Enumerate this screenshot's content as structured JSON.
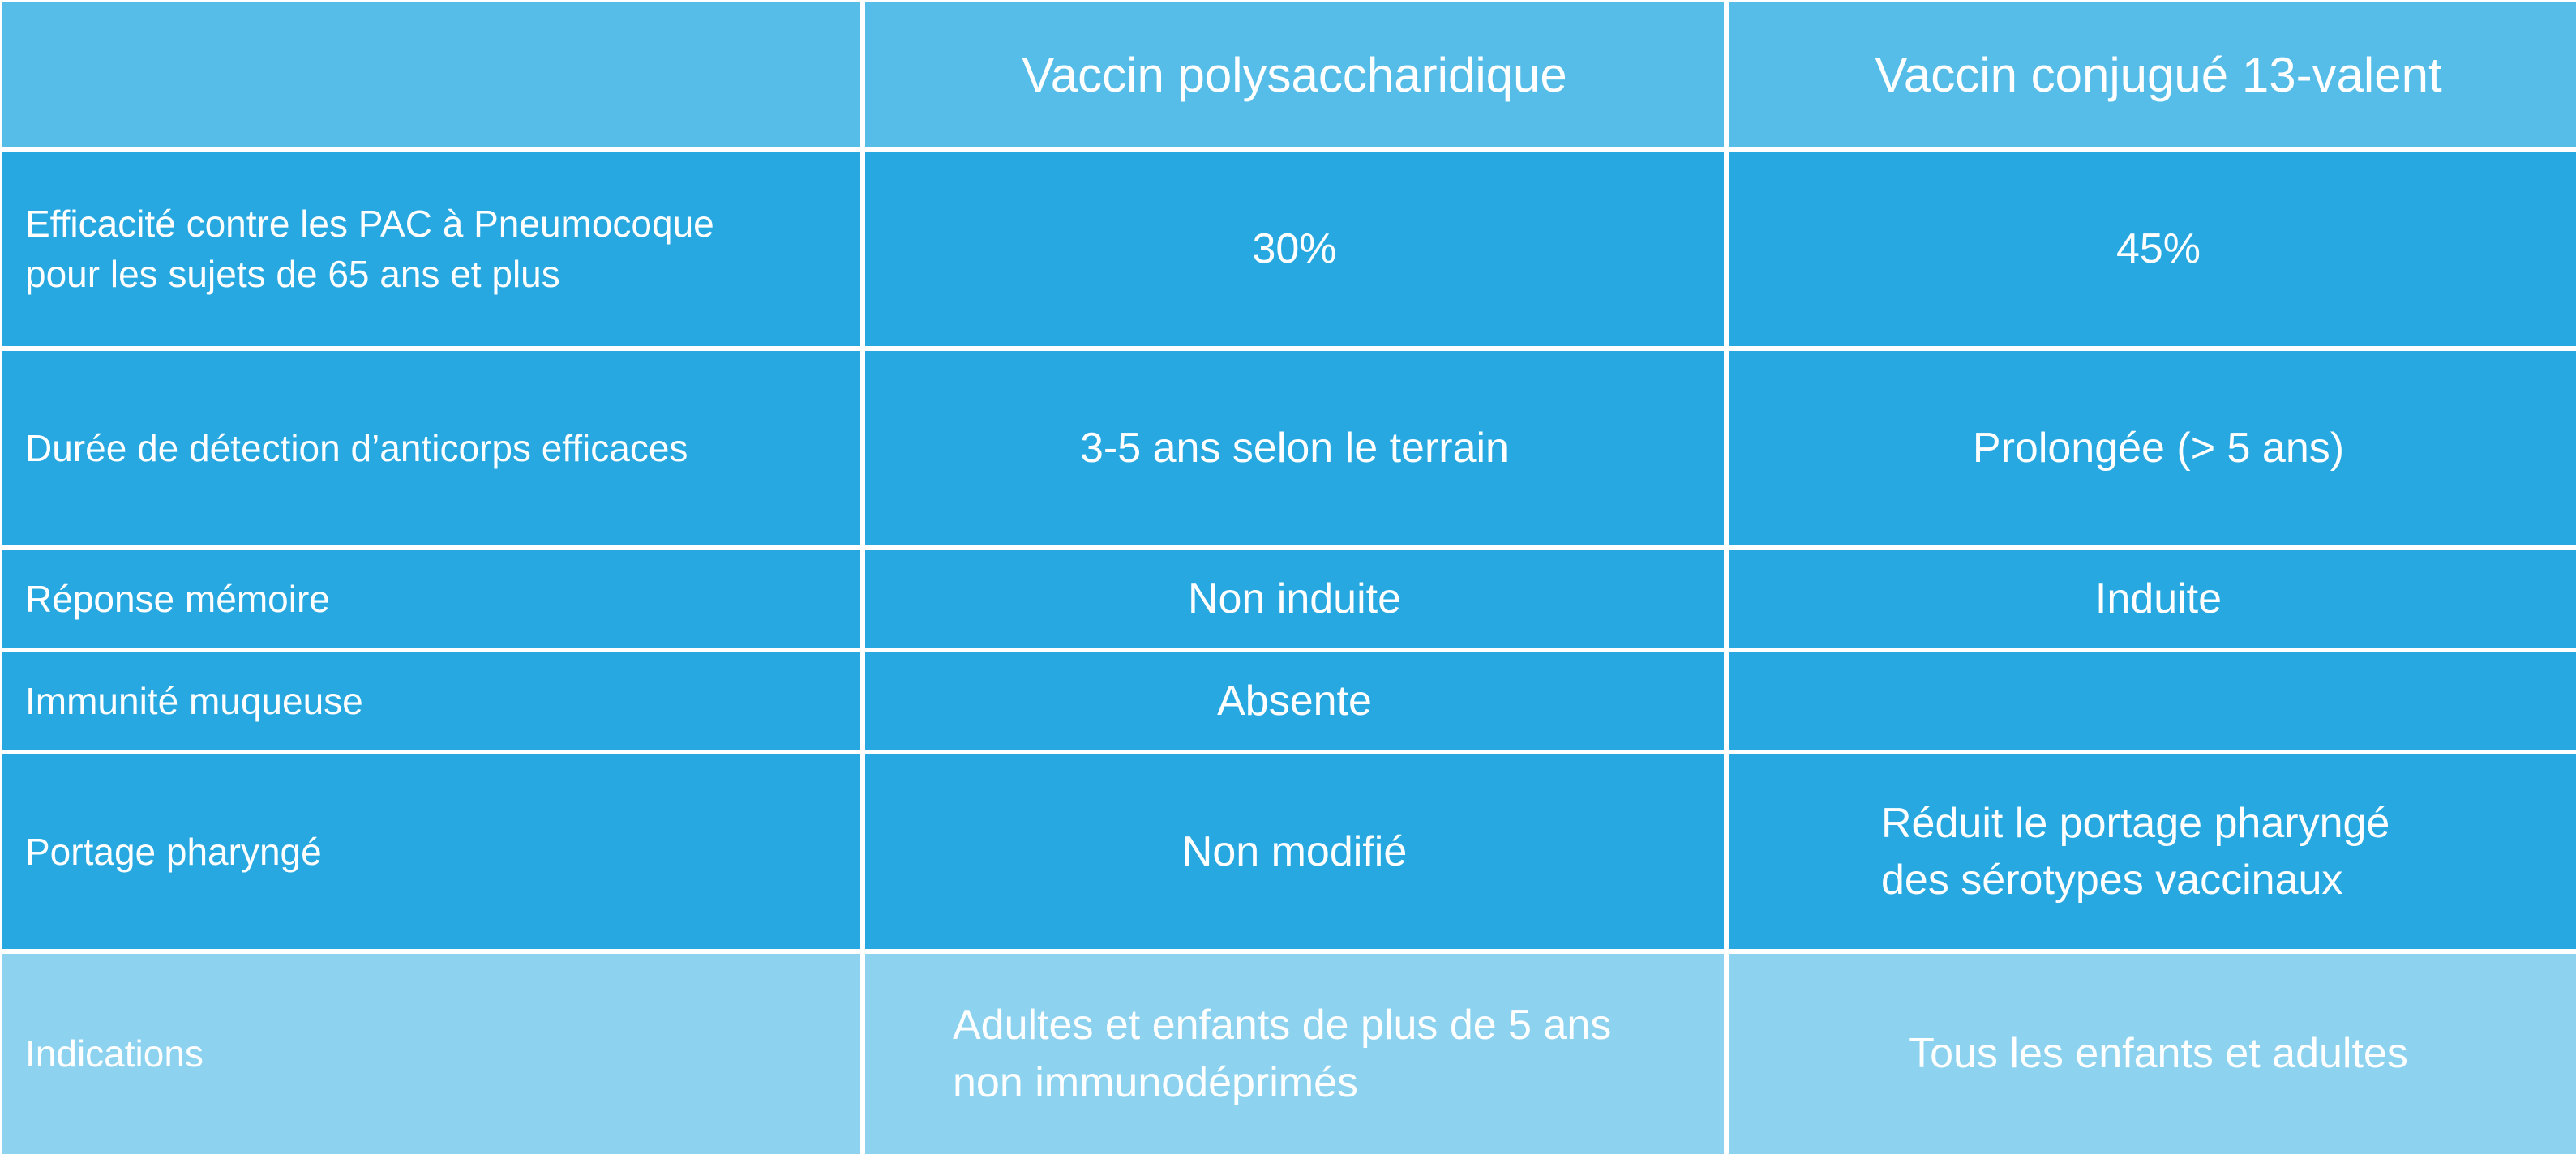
{
  "table": {
    "header": {
      "blank": "",
      "col1": "Vaccin polysaccharidique",
      "col2": "Vaccin conjugué 13-valent"
    },
    "rows": [
      {
        "label": "Efficacité contre les PAC à Pneumocoque\npour les sujets de 65 ans et plus",
        "col1": "30%",
        "col2": "45%"
      },
      {
        "label": "Durée de détection d’anticorps efficaces",
        "col1": "3-5 ans selon le terrain",
        "col2": "Prolongée (> 5 ans)"
      },
      {
        "label": "Réponse mémoire",
        "col1": "Non induite",
        "col2": "Induite"
      },
      {
        "label": "Immunité muqueuse",
        "col1": "Absente",
        "col2": ""
      },
      {
        "label": "Portage pharyngé",
        "col1": "Non modifié",
        "col2": "Réduit le portage pharyngé\ndes sérotypes vaccinaux"
      },
      {
        "label": "Indications",
        "col1": "Adultes et enfants de plus de 5 ans\nnon immunodéprimés",
        "col2": "Tous les enfants et adultes"
      }
    ]
  },
  "colors": {
    "header_bg": "#55bde8",
    "body_bg": "#27a8e0",
    "last_row_bg": "#8dd3f0",
    "grid_lines": "#ffffff",
    "text": "#ffffff"
  }
}
